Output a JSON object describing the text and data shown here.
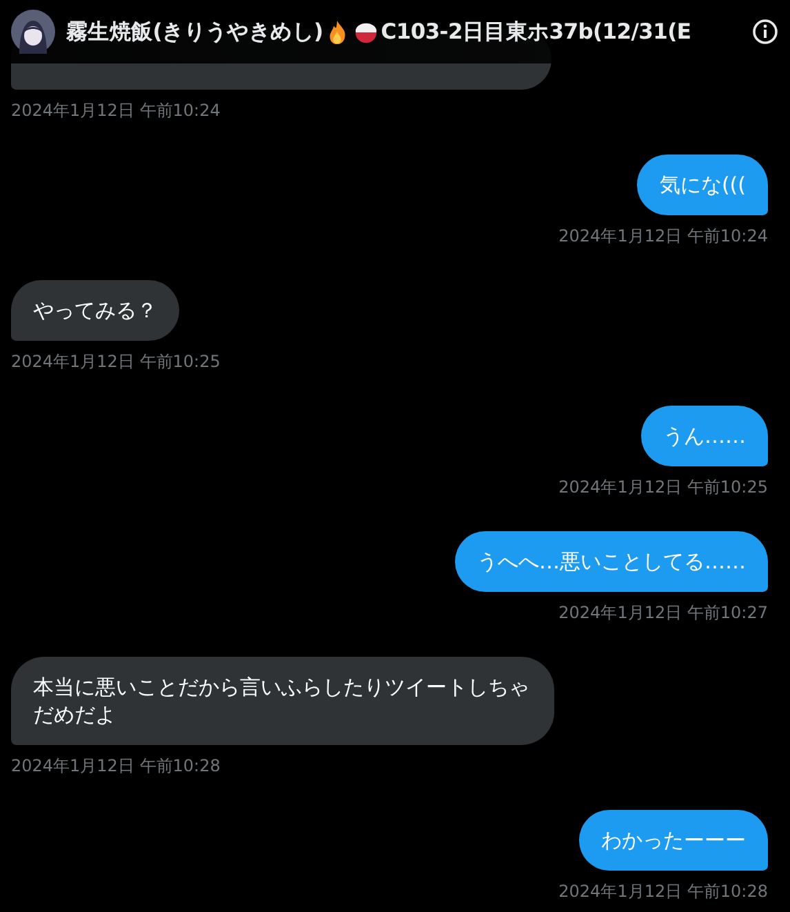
{
  "header": {
    "name": "霧生焼飯(きりうやきめし)",
    "name_suffix": "C103-2日目東ホ37b(12/31(E"
  },
  "messages": [
    {
      "kind": "received",
      "time": "2024年1月12日 午前10:24"
    },
    {
      "kind": "sent",
      "text": "気にな(((",
      "time": "2024年1月12日 午前10:24"
    },
    {
      "kind": "received",
      "text": "やってみる？",
      "time": "2024年1月12日 午前10:25"
    },
    {
      "kind": "sent",
      "text": "うん……",
      "time": "2024年1月12日 午前10:25"
    },
    {
      "kind": "sent",
      "text": "うへへ…悪いことしてる……",
      "time": "2024年1月12日 午前10:27"
    },
    {
      "kind": "received",
      "text": "本当に悪いことだから言いふらしたりツイートしちゃだめだよ",
      "time": "2024年1月12日 午前10:28"
    },
    {
      "kind": "sent",
      "text": "わかったーーー",
      "time": "2024年1月12日 午前10:28"
    }
  ]
}
